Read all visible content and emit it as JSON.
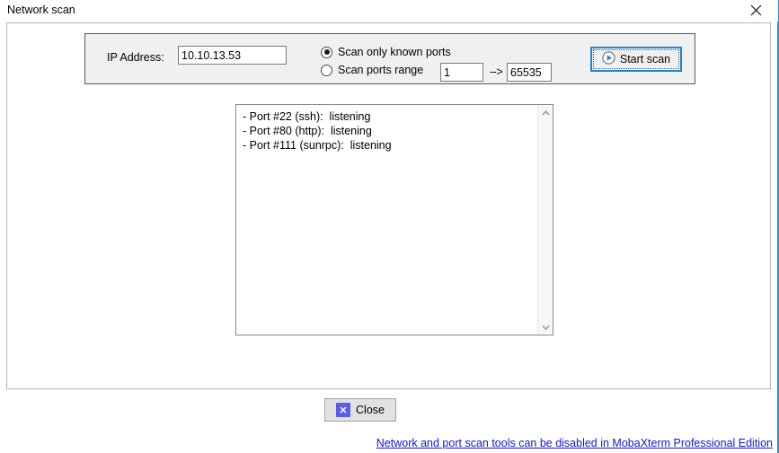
{
  "window": {
    "title": "Network scan",
    "close_icon": "close-x-icon"
  },
  "settings": {
    "ip_label": "IP Address:",
    "ip_value": "10.10.13.53",
    "ip_placeholder": "",
    "scan_mode": {
      "known_ports_label": "Scan only known ports",
      "known_ports_selected": true,
      "ports_range_label": "Scan ports range",
      "ports_range_selected": false,
      "range_from": "1",
      "range_arrow": "-->",
      "range_to": "65535"
    },
    "start_scan_label": "Start scan",
    "start_scan_icon": "play-circle-icon",
    "accent_focus_color": "#1886d8"
  },
  "results": {
    "lines": [
      "- Port #22 (ssh):  listening",
      "- Port #80 (http):  listening",
      "- Port #111 (sunrpc):  listening"
    ],
    "text": "- Port #22 (ssh):  listening\n- Port #80 (http):  listening\n- Port #111 (sunrpc):  listening",
    "scrollbar": {
      "up_icon": "chevron-up-icon",
      "down_icon": "chevron-down-icon"
    }
  },
  "footer": {
    "close_label": "Close",
    "close_icon": "x-square-icon",
    "close_icon_color": "#5b5bee",
    "pro_link_text": "Network and port scan tools can be disabled in MobaXterm Professional Edition",
    "pro_link_color": "#1414d6"
  }
}
